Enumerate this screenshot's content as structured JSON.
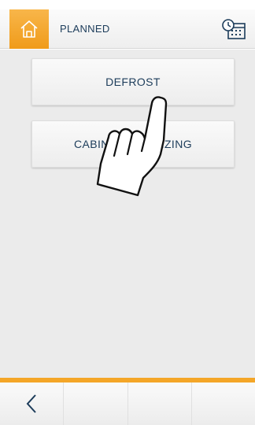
{
  "header": {
    "title": "PLANNED",
    "home_icon": "home-icon",
    "schedule_icon": "schedule-icon"
  },
  "menu": {
    "items": [
      {
        "label": "DEFROST"
      },
      {
        "label": "CABINET SANITIZING"
      }
    ]
  },
  "footer": {
    "back_icon": "chevron-left-icon"
  },
  "colors": {
    "accent": "#f4a628",
    "text": "#1c3c5a",
    "background": "#ebebeb"
  }
}
